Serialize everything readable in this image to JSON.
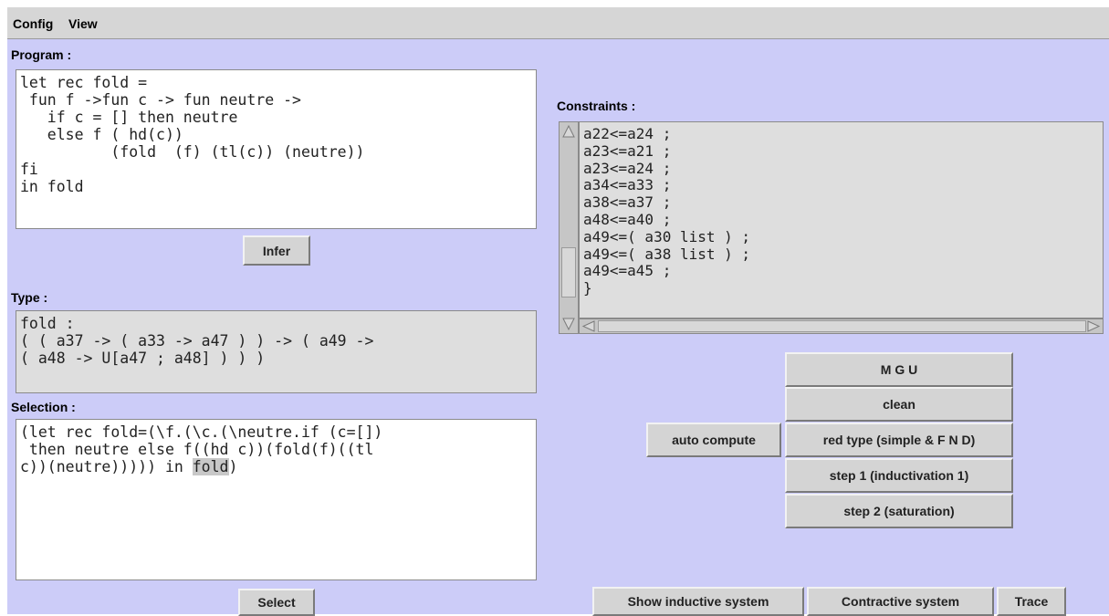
{
  "menu": {
    "config": "Config",
    "view": "View"
  },
  "program": {
    "label": "Program :",
    "code": "let rec fold =\n fun f ->fun c -> fun neutre ->\n   if c = [] then neutre\n   else f ( hd(c))\n          (fold  (f) (tl(c)) (neutre))\nfi\nin fold"
  },
  "infer_button": "Infer",
  "type": {
    "label": "Type :",
    "text": "fold :\n( ( a37 -> ( a33 -> a47 ) ) -> ( a49 ->\n( a48 -> U[a47 ; a48] ) ) )"
  },
  "selection": {
    "label": "Selection :",
    "before": "(let rec fold=(\\f.(\\c.(\\neutre.if (c=[])\n then neutre else f((hd c))(fold(f)((tl\nc))(neutre))))) in ",
    "highlight": "fold",
    "after": ")"
  },
  "select_button": "Select",
  "constraints": {
    "label": "Constraints :",
    "text": "a22<=a24 ;\na23<=a21 ;\na23<=a24 ;\na34<=a33 ;\na38<=a37 ;\na48<=a40 ;\na49<=( a30 list ) ;\na49<=( a38 list ) ;\na49<=a45 ;\n}"
  },
  "buttons": {
    "mgu": "M G U",
    "clean": "clean",
    "auto_compute": "auto compute",
    "red_type": "red type (simple & F N D)",
    "step1": "step 1 (inductivation 1)",
    "step2": "step 2 (saturation)",
    "show_inductive": "Show inductive system",
    "contractive": "Contractive system",
    "trace": "Trace"
  }
}
